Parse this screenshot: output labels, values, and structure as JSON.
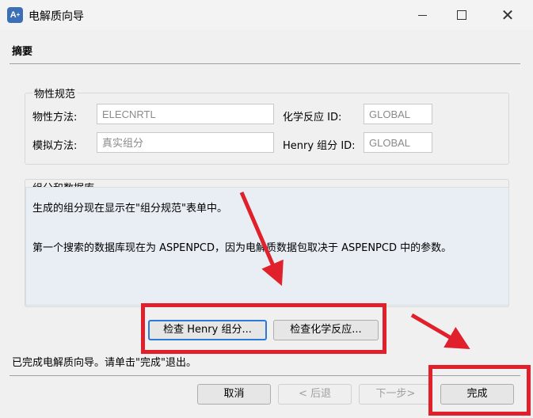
{
  "window": {
    "title": "电解质向导"
  },
  "header": {
    "section_title": "摘要"
  },
  "property_spec": {
    "group_label": "物性规范",
    "method_label": "物性方法:",
    "method_value": "ELECNRTL",
    "sim_label": "模拟方法:",
    "sim_value": "真实组分",
    "chem_id_label": "化学反应 ID:",
    "chem_id_value": "GLOBAL",
    "henry_id_label": "Henry 组分 ID:",
    "henry_id_value": "GLOBAL"
  },
  "components": {
    "group_label": "组分和数据库",
    "message_1": "生成的组分现在显示在\"组分规范\"表单中。",
    "message_2": "第一个搜索的数据库现在为 ASPENPCD，因为电解质数据包取决于 ASPENPCD 中的参数。"
  },
  "review_buttons": {
    "henry_label": "检查 Henry 组分...",
    "reaction_label": "检查化学反应..."
  },
  "status_text": "已完成电解质向导。请单击\"完成\"退出。",
  "footer": {
    "cancel_label": "取消",
    "back_label": "< 后退",
    "next_label": "下一步>",
    "finish_label": "完成"
  },
  "annotation_color": "#e0202a"
}
